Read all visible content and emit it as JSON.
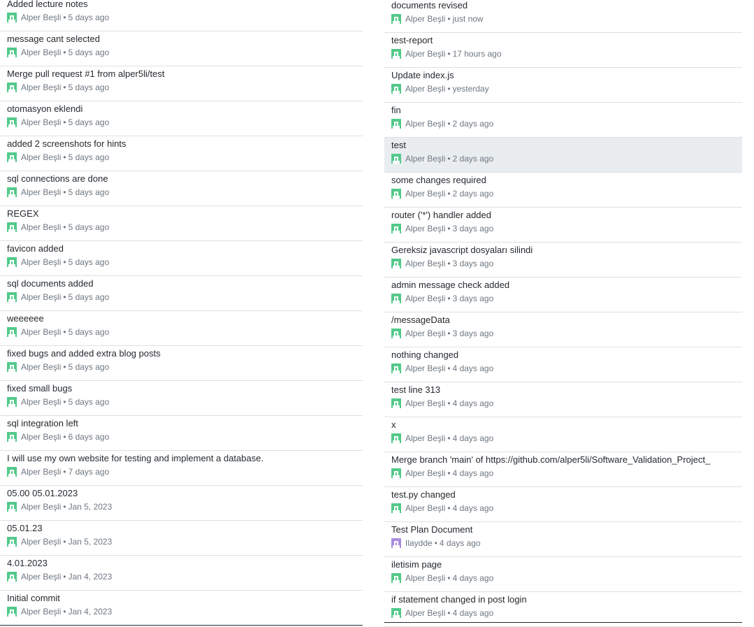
{
  "colors": {
    "avatar_green": "#53c98a",
    "avatar_purple": "#a98be0",
    "highlight_row": "#e9edf0"
  },
  "left_commits": [
    {
      "message": "Added lecture notes",
      "author": "Alper Beşli",
      "time": "5 days ago",
      "avatar": "green"
    },
    {
      "message": "message cant selected",
      "author": "Alper Beşli",
      "time": "5 days ago",
      "avatar": "green"
    },
    {
      "message": "Merge pull request #1 from alper5li/test",
      "author": "Alper Beşli",
      "time": "5 days ago",
      "avatar": "green"
    },
    {
      "message": "otomasyon eklendi",
      "author": "Alper Beşli",
      "time": "5 days ago",
      "avatar": "green"
    },
    {
      "message": "added 2 screenshots for hints",
      "author": "Alper Beşli",
      "time": "5 days ago",
      "avatar": "green"
    },
    {
      "message": "sql connections are done",
      "author": "Alper Beşli",
      "time": "5 days ago",
      "avatar": "green"
    },
    {
      "message": "REGEX",
      "author": "Alper Beşli",
      "time": "5 days ago",
      "avatar": "green"
    },
    {
      "message": "favicon added",
      "author": "Alper Beşli",
      "time": "5 days ago",
      "avatar": "green"
    },
    {
      "message": "sql documents added",
      "author": "Alper Beşli",
      "time": "5 days ago",
      "avatar": "green"
    },
    {
      "message": "weeeeee",
      "author": "Alper Beşli",
      "time": "5 days ago",
      "avatar": "green"
    },
    {
      "message": "fixed bugs and added extra blog posts",
      "author": "Alper Beşli",
      "time": "5 days ago",
      "avatar": "green"
    },
    {
      "message": "fixed small bugs",
      "author": "Alper Beşli",
      "time": "5 days ago",
      "avatar": "green"
    },
    {
      "message": "sql integration left",
      "author": "Alper Beşli",
      "time": "6 days ago",
      "avatar": "green"
    },
    {
      "message": "I will use my own website for testing and implement a database.",
      "author": "Alper Beşli",
      "time": "7 days ago",
      "avatar": "green"
    },
    {
      "message": "05.00 05.01.2023",
      "author": "Alper Beşli",
      "time": "Jan 5, 2023",
      "avatar": "green"
    },
    {
      "message": "05.01.23",
      "author": "Alper Beşli",
      "time": "Jan 5, 2023",
      "avatar": "green"
    },
    {
      "message": "4.01.2023",
      "author": "Alper Beşli",
      "time": "Jan 4, 2023",
      "avatar": "green"
    },
    {
      "message": "Initial commit",
      "author": "Alper Beşli",
      "time": "Jan 4, 2023",
      "avatar": "green"
    }
  ],
  "right_commits": [
    {
      "message": "documents revised",
      "author": "Alper Beşli",
      "time": "just now",
      "avatar": "green"
    },
    {
      "message": "test-report",
      "author": "Alper Beşli",
      "time": "17 hours ago",
      "avatar": "green"
    },
    {
      "message": "Update index.js",
      "author": "Alper Beşli",
      "time": "yesterday",
      "avatar": "green"
    },
    {
      "message": "fin",
      "author": "Alper Beşli",
      "time": "2 days ago",
      "avatar": "green"
    },
    {
      "message": "test",
      "author": "Alper Beşli",
      "time": "2 days ago",
      "avatar": "green",
      "highlight": true
    },
    {
      "message": "some changes required",
      "author": "Alper Beşli",
      "time": "2 days ago",
      "avatar": "green"
    },
    {
      "message": "router ('*') handler added",
      "author": "Alper Beşli",
      "time": "3 days ago",
      "avatar": "green"
    },
    {
      "message": "Gereksiz javascript dosyaları silindi",
      "author": "Alper Beşli",
      "time": "3 days ago",
      "avatar": "green"
    },
    {
      "message": "admin message check added",
      "author": "Alper Beşli",
      "time": "3 days ago",
      "avatar": "green"
    },
    {
      "message": "/messageData",
      "author": "Alper Beşli",
      "time": "3 days ago",
      "avatar": "green"
    },
    {
      "message": "nothing changed",
      "author": "Alper Beşli",
      "time": "4 days ago",
      "avatar": "green"
    },
    {
      "message": "test line 313",
      "author": "Alper Beşli",
      "time": "4 days ago",
      "avatar": "green"
    },
    {
      "message": "x",
      "author": "Alper Beşli",
      "time": "4 days ago",
      "avatar": "green"
    },
    {
      "message": "Merge branch 'main' of https://github.com/alper5li/Software_Validation_Project_",
      "author": "Alper Beşli",
      "time": "4 days ago",
      "avatar": "green"
    },
    {
      "message": "test.py changed",
      "author": "Alper Beşli",
      "time": "4 days ago",
      "avatar": "green"
    },
    {
      "message": "Test Plan Document",
      "author": "Ilaydde",
      "time": "4 days ago",
      "avatar": "purple"
    },
    {
      "message": "iletisim page",
      "author": "Alper Beşli",
      "time": "4 days ago",
      "avatar": "green"
    },
    {
      "message": "if statement changed in post login",
      "author": "Alper Beşli",
      "time": "4 days ago",
      "avatar": "green"
    }
  ]
}
